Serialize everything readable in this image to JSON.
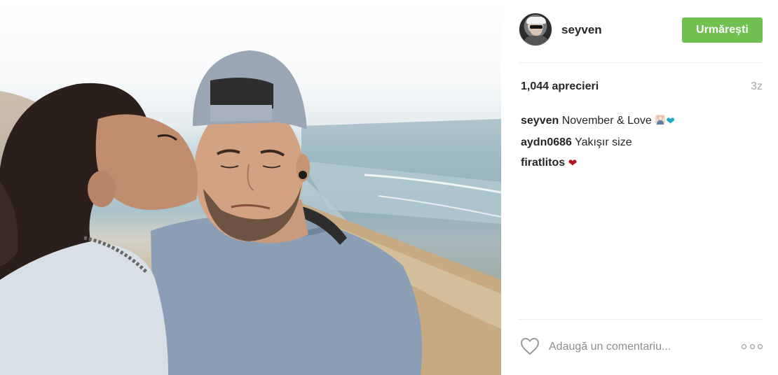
{
  "post": {
    "photo_alt": "Photo by seyven"
  },
  "header": {
    "username": "seyven",
    "follow_label": "Urmărești"
  },
  "stats": {
    "likes": "1,044 aprecieri",
    "time": "3z"
  },
  "comments": [
    {
      "author": "seyven",
      "text": "November & Love",
      "emojis": [
        "person-emoji",
        "blue-heart-emoji"
      ]
    },
    {
      "author": "aydn0686",
      "text": "Yakışır size"
    },
    {
      "author": "firatlitos",
      "text": "",
      "emojis": [
        "red-heart-emoji"
      ]
    }
  ],
  "comment_bar": {
    "placeholder": "Adaugă un comentariu..."
  },
  "colors": {
    "follow_button": "#70c050",
    "blue_heart": "#1fa7c6",
    "red_heart": "#b5121b",
    "muted": "#8e8e8e"
  },
  "icons": {
    "like": "heart-outline-icon",
    "more": "more-options-icon"
  }
}
